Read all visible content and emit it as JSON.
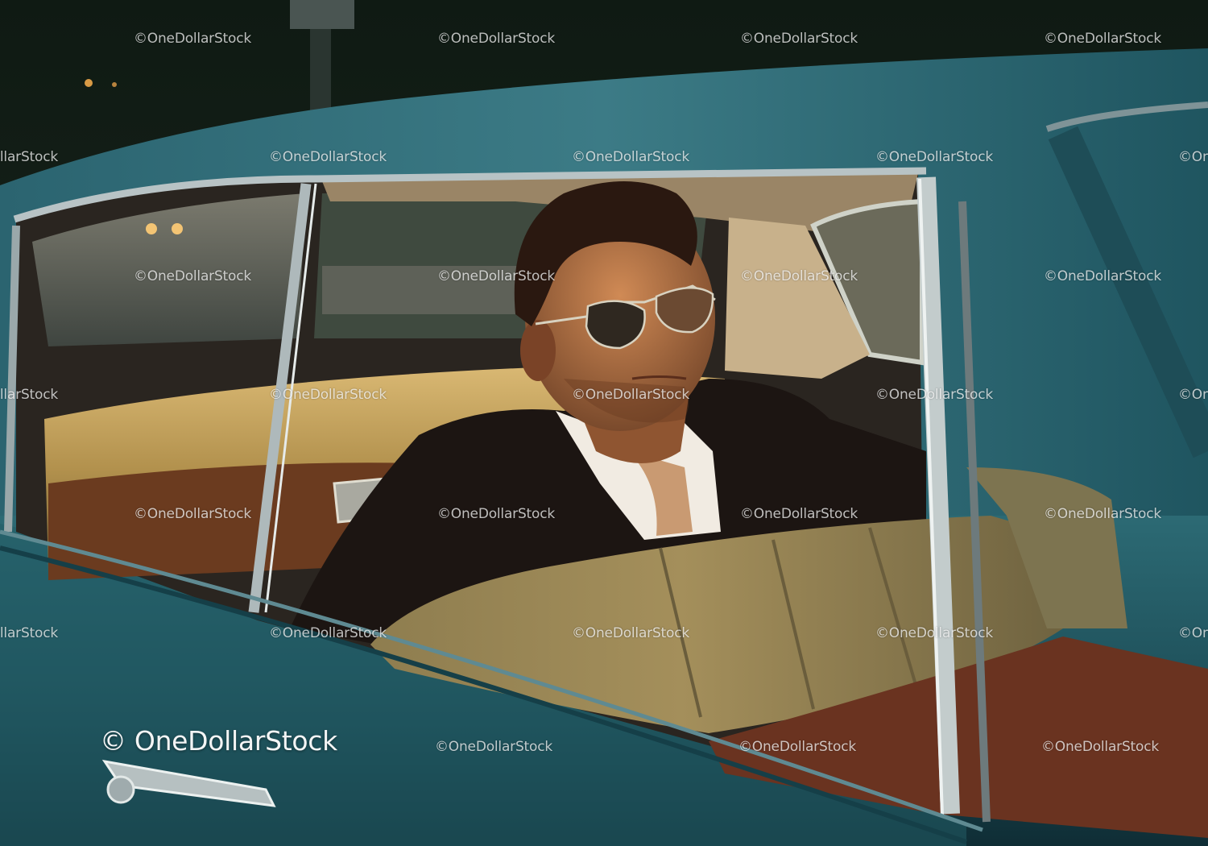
{
  "watermark": {
    "text": "©OneDollarStock",
    "main_text": "© OneDollarStock"
  },
  "colors": {
    "car_body": "#1f5560",
    "window_chrome": "#b9c4c6",
    "seat_leather": "#b89a55",
    "door_panel": "#6a3a1f",
    "jacket": "#1c1512",
    "shirt": "#f2ede6"
  }
}
